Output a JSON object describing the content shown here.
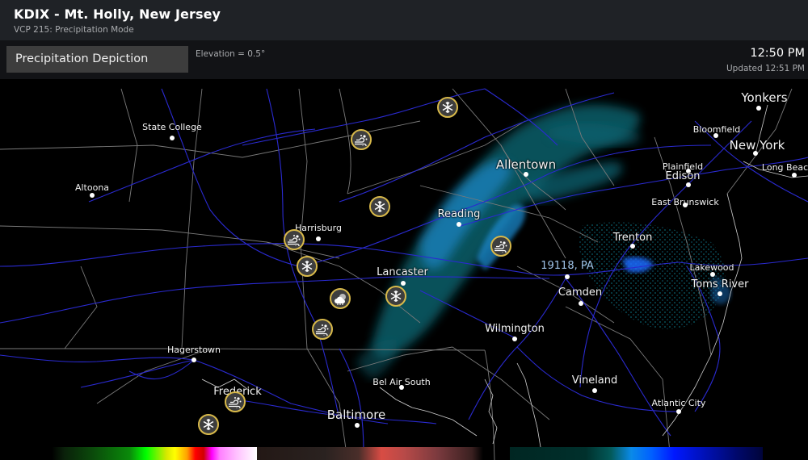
{
  "header": {
    "title": "KDIX - Mt. Holly, New Jersey",
    "subtitle": "VCP 215: Precipitation Mode"
  },
  "toolbar": {
    "mode_button": "Precipitation Depiction",
    "elevation": "Elevation = 0.5°",
    "time": "12:50 PM",
    "updated": "Updated 12:51 PM"
  },
  "map": {
    "cities": [
      {
        "name": "Yonkers",
        "size": "lg"
      },
      {
        "name": "Bloomfield",
        "size": "sm"
      },
      {
        "name": "New York",
        "size": "lg"
      },
      {
        "name": "Plainfield",
        "size": "sm"
      },
      {
        "name": "Edison",
        "size": "md"
      },
      {
        "name": "Long Beach",
        "size": "sm"
      },
      {
        "name": "East Brunswick",
        "size": "sm"
      },
      {
        "name": "State College",
        "size": "sm"
      },
      {
        "name": "Altoona",
        "size": "sm"
      },
      {
        "name": "Allentown",
        "size": "lg"
      },
      {
        "name": "Reading",
        "size": "md"
      },
      {
        "name": "Harrisburg",
        "size": "sm"
      },
      {
        "name": "Lancaster",
        "size": "md"
      },
      {
        "name": "Trenton",
        "size": "md"
      },
      {
        "name": "19118, PA",
        "size": "md",
        "is_user_location": true
      },
      {
        "name": "Camden",
        "size": "md"
      },
      {
        "name": "Lakewood",
        "size": "sm"
      },
      {
        "name": "Toms River",
        "size": "md"
      },
      {
        "name": "Wilmington",
        "size": "md"
      },
      {
        "name": "Hagerstown",
        "size": "sm"
      },
      {
        "name": "Bel Air South",
        "size": "sm"
      },
      {
        "name": "Vineland",
        "size": "md"
      },
      {
        "name": "Frederick",
        "size": "md"
      },
      {
        "name": "Baltimore",
        "size": "lg"
      },
      {
        "name": "Atlantic City",
        "size": "sm"
      }
    ],
    "weather_icons": [
      {
        "type": "snow",
        "name": "snowflake-icon"
      },
      {
        "type": "blowing-snow",
        "name": "blowing-snow-icon"
      },
      {
        "type": "snow",
        "name": "snowflake-icon"
      },
      {
        "type": "blowing-snow",
        "name": "blowing-snow-icon"
      },
      {
        "type": "snow",
        "name": "snowflake-icon"
      },
      {
        "type": "cloudy-snow",
        "name": "cloud-snow-icon"
      },
      {
        "type": "snow",
        "name": "snowflake-icon"
      },
      {
        "type": "blowing-snow",
        "name": "blowing-snow-icon"
      },
      {
        "type": "blowing-snow",
        "name": "blowing-snow-icon"
      },
      {
        "type": "blowing-snow",
        "name": "blowing-snow-icon"
      },
      {
        "type": "snow",
        "name": "snowflake-icon"
      }
    ]
  },
  "legend": {
    "scales": [
      {
        "name": "rain",
        "colors": [
          "#0a200a",
          "#0a8a0a",
          "#00ff00",
          "#ffff00",
          "#ff0000",
          "#ff00ff",
          "#ffffff"
        ]
      },
      {
        "name": "mix",
        "colors": [
          "#231815",
          "#4a2e2a",
          "#d84c44",
          "#7a3a3e"
        ]
      },
      {
        "name": "snow",
        "colors": [
          "#002622",
          "#035a5a",
          "#0a8ae8",
          "#0018ff",
          "#00043a"
        ]
      }
    ]
  },
  "colors": {
    "road": "#2a2ad0",
    "county_line": "#7a7a7a",
    "icon_ring": "#d8b94a",
    "user_location_label": "#9fc3e8"
  }
}
